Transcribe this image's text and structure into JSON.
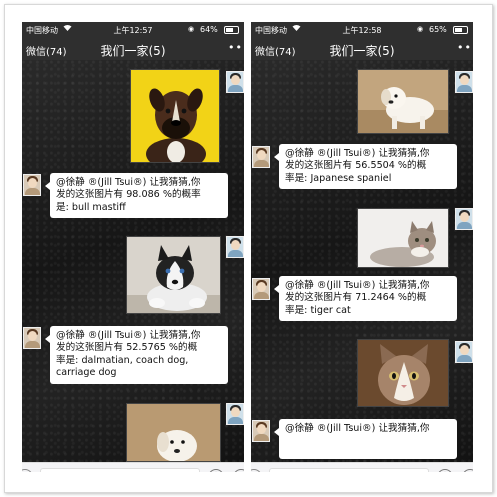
{
  "left_screen": {
    "status": {
      "carrier": "中国移动",
      "time": "上午12:57",
      "battery": "64%",
      "battery_level": 0.64
    },
    "nav": {
      "back": "微信(74)",
      "title": "我们一家(5)",
      "more": "••"
    },
    "messages": [
      {
        "type": "image",
        "sender": "self",
        "image": "boxer-dog-photo"
      },
      {
        "type": "text",
        "sender": "other",
        "text": "@徐静 ®(Jill Tsui®) 让我猜猜,你\n发的这张图片有 98.086 %的概率\n是: bull mastiff"
      },
      {
        "type": "image",
        "sender": "self",
        "image": "husky-puppy-photo"
      },
      {
        "type": "text",
        "sender": "other",
        "text": "@徐静 ®(Jill Tsui®) 让我猜猜,你\n发的这张图片有 52.5765 %的概\n率是: dalmatian, coach dog,\ncarriage dog"
      },
      {
        "type": "image",
        "sender": "self",
        "image": "white-puppy-photo"
      }
    ]
  },
  "right_screen": {
    "status": {
      "carrier": "中国移动",
      "time": "上午12:58",
      "battery": "65%",
      "battery_level": 0.65
    },
    "nav": {
      "back": "微信(74)",
      "title": "我们一家(5)",
      "more": "••"
    },
    "messages": [
      {
        "type": "image",
        "sender": "self",
        "image": "white-puppy-photo"
      },
      {
        "type": "text",
        "sender": "other",
        "text": "@徐静 ®(Jill Tsui®) 让我猜猜,你\n发的这张图片有 56.5504 %的概\n率是: Japanese spaniel"
      },
      {
        "type": "image",
        "sender": "self",
        "image": "kitten-lying-photo"
      },
      {
        "type": "text",
        "sender": "other",
        "text": "@徐静 ®(Jill Tsui®) 让我猜猜,你\n发的这张图片有 71.2464 %的概\n率是: tiger cat"
      },
      {
        "type": "image",
        "sender": "self",
        "image": "tabby-cat-photo"
      },
      {
        "type": "text",
        "sender": "other",
        "text": "@徐静 ®(Jill Tsui®) 让我猜猜,你"
      }
    ]
  },
  "input_bar": {
    "voice_icon": "voice-icon",
    "emoji_icon": "emoji-icon",
    "plus_icon": "plus-icon"
  },
  "colors": {
    "nav_bg": "#2f2f2f",
    "bubble_bg": "#ffffff",
    "chat_bg": "#1c1c1c",
    "yellow_bg": "#f2d317"
  }
}
